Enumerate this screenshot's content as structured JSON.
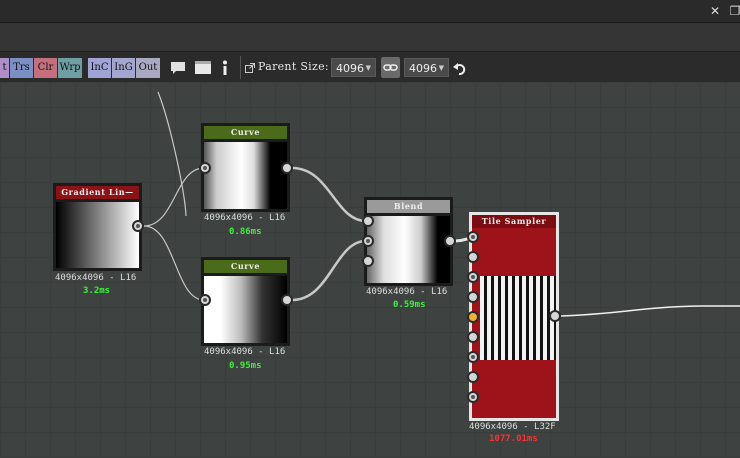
{
  "window": {
    "pin_icon": "pin-icon",
    "restore_icon": "restore-window-icon"
  },
  "toolbar": {
    "tags": [
      {
        "label": "t",
        "color": "#b08fc8"
      },
      {
        "label": "Trs",
        "color": "#7c8fc4"
      },
      {
        "label": "Clr",
        "color": "#c4707c"
      },
      {
        "label": "Wrp",
        "color": "#6f9ea5"
      },
      {
        "label": "InC",
        "color": "#9fa3d6"
      },
      {
        "label": "InG",
        "color": "#a3a6cf"
      },
      {
        "label": "Out",
        "color": "#a9a9c4"
      }
    ],
    "parent_size_label": "Parent Size:",
    "parent_size_value": "4096",
    "second_size_value": "4096"
  },
  "nodes": {
    "gradient": {
      "title": "Gradient Lin—",
      "res": "4096x4096 - L16",
      "time": "3.2ms",
      "header_color": "#8a1318"
    },
    "curve_top": {
      "title": "Curve",
      "res": "4096x4096 - L16",
      "time": "0.86ms",
      "header_color": "#4a6b1a"
    },
    "curve_bottom": {
      "title": "Curve",
      "res": "4096x4096 - L16",
      "time": "0.95ms",
      "header_color": "#4a6b1a"
    },
    "blend": {
      "title": "Blend",
      "res": "4096x4096 - L16",
      "time": "0.59ms",
      "header_color": "#9a9a9a"
    },
    "tile_sampler": {
      "title": "Tile Sampler",
      "res": "4096x4096 - L32F",
      "time": "1077.01ms",
      "header_color": "#9e1219"
    }
  },
  "colors": {
    "time_ok": "#3df03d",
    "time_slow": "#ff3030",
    "port_accent": "#f0b030"
  }
}
